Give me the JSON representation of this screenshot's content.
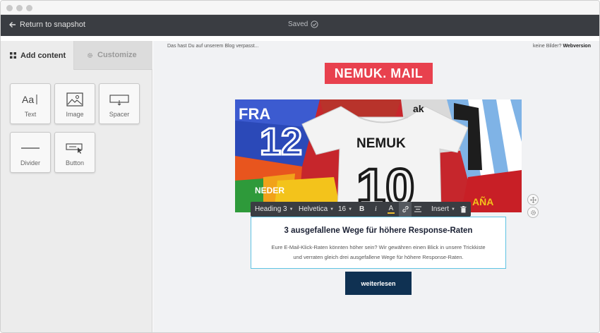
{
  "header": {
    "back_label": "Return to snapshot",
    "status": "Saved"
  },
  "sidebar": {
    "tabs": [
      {
        "label": "Add content",
        "icon": "grid-icon",
        "active": true
      },
      {
        "label": "Customize",
        "icon": "gear-icon",
        "active": false
      }
    ],
    "blocks": [
      {
        "label": "Text",
        "icon": "text-icon"
      },
      {
        "label": "Image",
        "icon": "image-icon"
      },
      {
        "label": "Spacer",
        "icon": "spacer-icon"
      },
      {
        "label": "Divider",
        "icon": "divider-icon"
      },
      {
        "label": "Button",
        "icon": "button-icon"
      }
    ]
  },
  "email": {
    "preheader": "Das hast Du auf unserem Blog verpasst...",
    "webversion_prefix": "keine Bilder?",
    "webversion_link": "Webversion",
    "logo": "NEMUK. MAIL",
    "logo_color": "#e8414e",
    "hero_jersey_name": "NEMUK",
    "hero_jersey_number": "10",
    "hero_left_number": "12",
    "hero_left_text": "FRA",
    "hero_bottom_text": "NEDER",
    "hero_right_text": "AÑA",
    "hero_top_right_text": "ak",
    "heading": "3 ausgefallene Wege für höhere Response-Raten",
    "body_line1": "Eure E-Mail-Klick-Raten könnten höher sein? Wir gewähren einen Blick in unsere Trickkiste",
    "body_line2": "und verraten gleich drei ausgefallene Wege für höhere Response-Raten.",
    "cta_label": "weiterlesen",
    "cta_color": "#0f3152"
  },
  "toolbar": {
    "style": "Heading 3",
    "font": "Helvetica",
    "size": "16",
    "bold": "B",
    "italic": "i",
    "color_letter": "A",
    "insert": "Insert"
  }
}
